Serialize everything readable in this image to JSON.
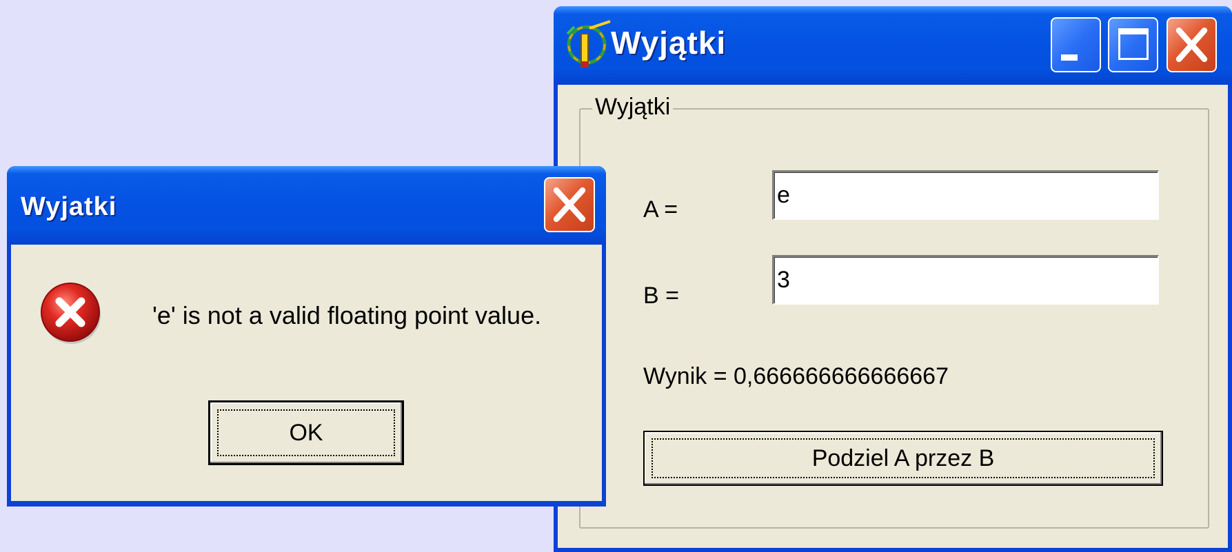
{
  "main_window": {
    "title": "Wyjątki",
    "groupbox_label": "Wyjątki",
    "label_a": "A =",
    "label_b": "B =",
    "input_a_value": "e",
    "input_b_value": "3",
    "result_text": "Wynik = 0,666666666666667",
    "divide_button_label": "Podziel A przez B",
    "icons": [
      "app-icon",
      "minimize-icon",
      "maximize-icon",
      "close-icon"
    ]
  },
  "message_box": {
    "title": "Wyjatki",
    "message": "'e' is not a valid floating point value.",
    "ok_label": "OK",
    "icons": [
      "error-icon",
      "close-icon"
    ]
  },
  "colors": {
    "desktop": "#e1e1fb",
    "titlebar": "#0553e3",
    "window_face": "#ece9d8",
    "close_button": "#e0582f",
    "error_red": "#d41b1b"
  }
}
